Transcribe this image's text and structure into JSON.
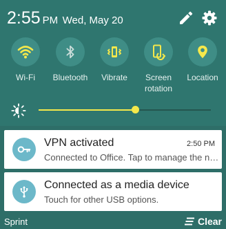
{
  "status": {
    "time": "2:55",
    "ampm": "PM",
    "date": "Wed, May 20"
  },
  "header_icons": [
    "pencil-icon",
    "gear-icon"
  ],
  "quick_settings": [
    {
      "label": "Wi-Fi",
      "icon": "wifi-icon",
      "active": true
    },
    {
      "label": "Bluetooth",
      "icon": "bluetooth-icon",
      "active": false
    },
    {
      "label": "Vibrate",
      "icon": "vibrate-icon",
      "active": true
    },
    {
      "label": "Screen rotation",
      "icon": "screen-rotation-icon",
      "active": true
    },
    {
      "label": "Location",
      "icon": "location-icon",
      "active": true
    }
  ],
  "brightness": {
    "level": 0.56,
    "icon": "brightness-icon"
  },
  "notifications": [
    {
      "title": "VPN activated",
      "text": "Connected to Office. Tap to manage the ne..",
      "time": "2:50 PM",
      "icon": "key-icon"
    },
    {
      "title": "Connected as a media device",
      "text": "Touch for other USB options.",
      "icon": "usb-icon"
    }
  ],
  "footer": {
    "carrier": "Sprint",
    "clear_label": "Clear"
  },
  "colors": {
    "panel": "#2f766f",
    "accent_active": "#f5e84b",
    "inactive": "#c9dcd9",
    "notification_icon_bg": "#6cb8c9"
  }
}
